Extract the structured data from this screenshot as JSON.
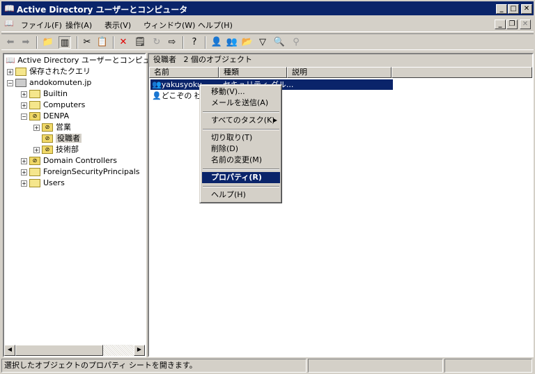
{
  "window": {
    "title": "Active Directory ユーザーとコンピュータ"
  },
  "menu": [
    "ファイル(F)",
    "操作(A)",
    "表示(V)",
    "ウィンドウ(W)",
    "ヘルプ(H)"
  ],
  "toolbar": [
    "back-icon",
    "forward-icon",
    "up-folder-icon",
    "show-tree-icon",
    "cut-icon",
    "paste-icon",
    "delete-icon",
    "properties-icon",
    "refresh-icon",
    "export-icon",
    "help-icon",
    "new-user-icon",
    "new-group-icon",
    "new-ou-icon",
    "filter-icon",
    "find-icon",
    "add-member-icon"
  ],
  "tree": {
    "root": "Active Directory ユーザーとコンピュータ",
    "items": [
      {
        "label": "保存されたクエリ"
      },
      {
        "label": "andokomuten.jp"
      },
      {
        "label": "Builtin"
      },
      {
        "label": "Computers"
      },
      {
        "label": "DENPA"
      },
      {
        "label": "営業"
      },
      {
        "label": "役職者"
      },
      {
        "label": "技術部"
      },
      {
        "label": "Domain Controllers"
      },
      {
        "label": "ForeignSecurityPrincipals"
      },
      {
        "label": "Users"
      }
    ]
  },
  "list": {
    "title": "役職者",
    "count": "2 個のオブジェクト",
    "columns": [
      "名前",
      "種類",
      "説明"
    ],
    "rows": [
      {
        "name": "yakusyoku",
        "type": "セキュリティ グル..."
      },
      {
        "name": "どこぞの 社..."
      }
    ]
  },
  "context_menu": [
    "移動(V)...",
    "メールを送信(A)",
    "すべてのタスク(K)",
    "切り取り(T)",
    "削除(D)",
    "名前の変更(M)",
    "プロパティ(R)",
    "ヘルプ(H)"
  ],
  "status": "選択したオブジェクトのプロパティ シートを開きます。",
  "colors": {
    "titlebar": "#0a246a",
    "highlight": "#0a246a"
  }
}
